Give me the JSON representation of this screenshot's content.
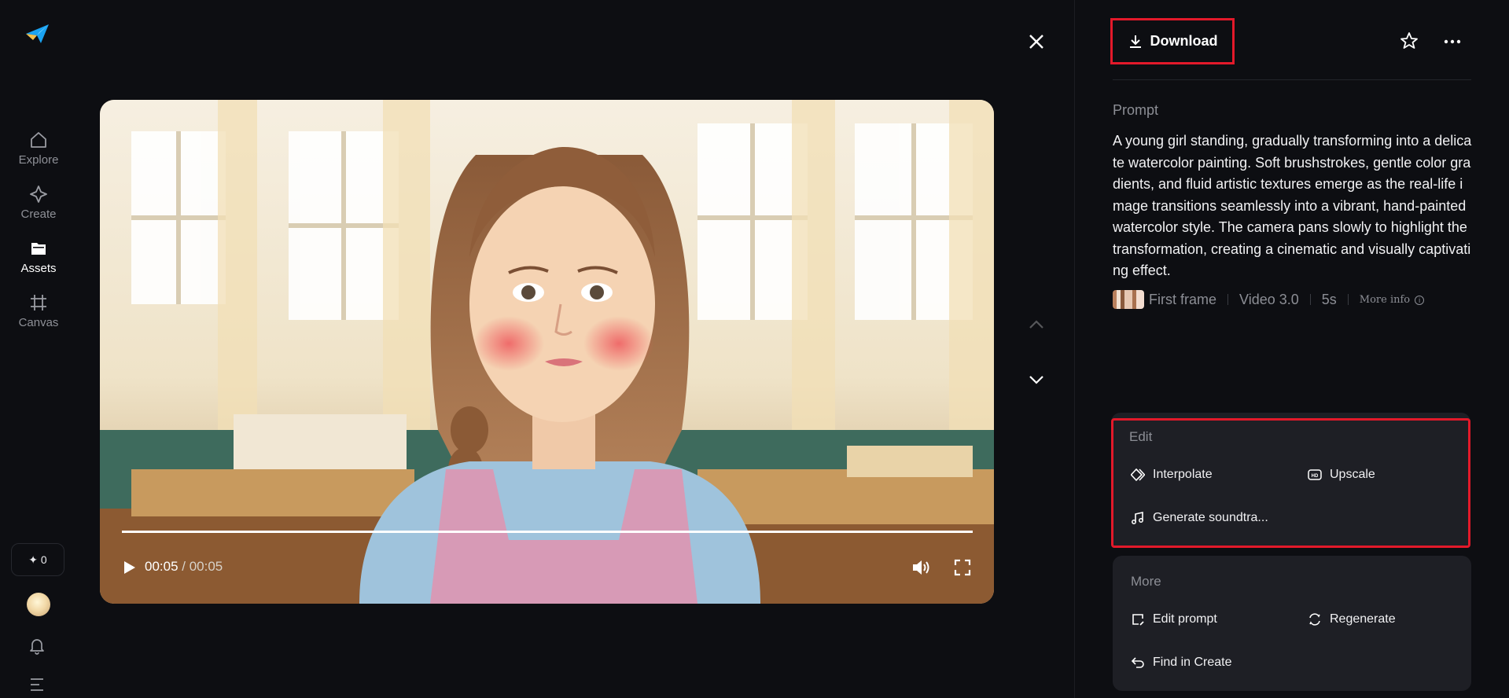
{
  "rail": {
    "items": [
      {
        "label": "Explore",
        "icon": "home-icon"
      },
      {
        "label": "Create",
        "icon": "sparkle-icon"
      },
      {
        "label": "Assets",
        "icon": "folder-icon",
        "active": true
      },
      {
        "label": "Canvas",
        "icon": "canvas-icon"
      }
    ],
    "credits": "✦ 0"
  },
  "player": {
    "current_time": "00:05",
    "separator": " / ",
    "duration": "00:05",
    "progress_fraction": 1.0
  },
  "header": {
    "download_label": "Download"
  },
  "prompt": {
    "label": "Prompt",
    "text": "A young girl standing, gradually transforming into a delicate watercolor painting. Soft brushstrokes, gentle color gradients, and fluid artistic textures emerge as the real-life image transitions seamlessly into a vibrant, hand-painted watercolor style. The camera pans slowly to highlight the transformation, creating a cinematic and visually captivating effect."
  },
  "meta": {
    "first_frame": "First frame",
    "model": "Video 3.0",
    "duration": "5s",
    "more_info": "More info"
  },
  "edit": {
    "title": "Edit",
    "interpolate": "Interpolate",
    "upscale": "Upscale",
    "soundtrack": "Generate soundtra..."
  },
  "more": {
    "title": "More",
    "edit_prompt": "Edit prompt",
    "regenerate": "Regenerate",
    "find_in_create": "Find in Create"
  },
  "colors": {
    "background": "#0d0e12",
    "card": "#1e1f25",
    "highlight": "#e3192a",
    "brand": "#1aa3f2"
  }
}
